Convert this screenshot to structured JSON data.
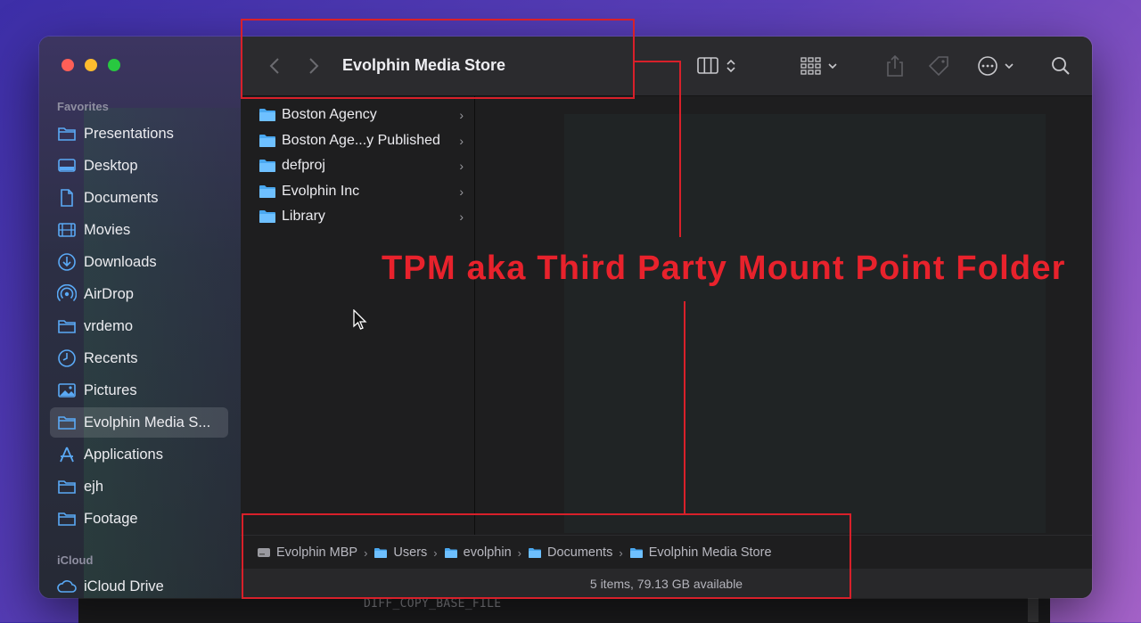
{
  "background": {
    "terminal_text": "DIFF_COPY_BASE_FILE"
  },
  "window": {
    "title": "Evolphin Media Store"
  },
  "sidebar": {
    "favorites_label": "Favorites",
    "favorites": [
      {
        "label": "Presentations",
        "icon": "folder-icon"
      },
      {
        "label": "Desktop",
        "icon": "desktop-icon"
      },
      {
        "label": "Documents",
        "icon": "document-icon"
      },
      {
        "label": "Movies",
        "icon": "film-icon"
      },
      {
        "label": "Downloads",
        "icon": "download-icon"
      },
      {
        "label": "AirDrop",
        "icon": "airdrop-icon"
      },
      {
        "label": "vrdemo",
        "icon": "folder-icon"
      },
      {
        "label": "Recents",
        "icon": "clock-icon"
      },
      {
        "label": "Pictures",
        "icon": "photo-icon"
      },
      {
        "label": "Evolphin Media S...",
        "icon": "folder-icon",
        "selected": true
      },
      {
        "label": "Applications",
        "icon": "applications-icon"
      },
      {
        "label": "ejh",
        "icon": "folder-icon"
      },
      {
        "label": "Footage",
        "icon": "folder-icon"
      }
    ],
    "icloud_label": "iCloud",
    "icloud": [
      {
        "label": "iCloud Drive",
        "icon": "cloud-icon"
      }
    ]
  },
  "columns": {
    "items": [
      {
        "label": "Boston Agency"
      },
      {
        "label": "Boston Age...y Published"
      },
      {
        "label": "defproj"
      },
      {
        "label": "Evolphin Inc"
      },
      {
        "label": "Library"
      }
    ]
  },
  "pathbar": {
    "crumbs": [
      "Evolphin MBP",
      "Users",
      "evolphin",
      "Documents",
      "Evolphin Media Store"
    ]
  },
  "status": {
    "text": "5 items, 79.13 GB available"
  },
  "annotation": {
    "label": "TPM aka Third Party Mount Point Folder",
    "color": "#d8202a"
  },
  "colors": {
    "folder_blue": "#4aa8f0",
    "accent": "#5aa9f5"
  }
}
